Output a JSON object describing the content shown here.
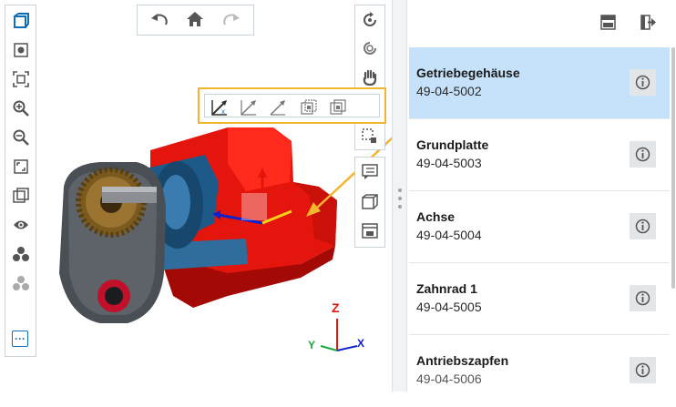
{
  "colors": {
    "accent": "#0e6fb8",
    "highlight": "#f2b52e",
    "selection": "#c6e2fa",
    "model_red": "#e3150c"
  },
  "left_toolbar": {
    "icons": [
      "cube-view-icon",
      "settings-icon",
      "fit-frame-icon",
      "zoom-in-icon",
      "zoom-out-icon",
      "fullscreen-icon",
      "box-icon",
      "eye-icon",
      "explode-icon",
      "explode-disabled-icon",
      "more-icon"
    ],
    "more_label": "···"
  },
  "top_toolbar": {
    "icons": [
      "undo-icon",
      "home-icon",
      "redo-icon"
    ]
  },
  "right_toolbar": {
    "icons": [
      "rotate-icon",
      "orbit-icon",
      "pan-hand-icon",
      "explode-settings-icon",
      "select-region-icon"
    ]
  },
  "right_toolbar2": {
    "icons": [
      "notes-icon",
      "cube-outline-icon",
      "print-icon"
    ]
  },
  "explode_popup": {
    "icons": [
      "explode-xyz-icon",
      "explode-x-icon",
      "explode-y-icon",
      "explode-z-icon",
      "explode-custom-icon"
    ]
  },
  "axes": {
    "z": "Z",
    "y": "Y",
    "x": "X"
  },
  "parts_list": {
    "header_icons": [
      "panel-layout-icon",
      "export-icon"
    ],
    "items": [
      {
        "name": "Getriebegehäuse",
        "number": "49-04-5002",
        "selected": true
      },
      {
        "name": "Grundplatte",
        "number": "49-04-5003",
        "selected": false
      },
      {
        "name": "Achse",
        "number": "49-04-5004",
        "selected": false
      },
      {
        "name": "Zahnrad 1",
        "number": "49-04-5005",
        "selected": false
      },
      {
        "name": "Antriebszapfen",
        "number": "49-04-5006",
        "selected": false
      }
    ]
  }
}
